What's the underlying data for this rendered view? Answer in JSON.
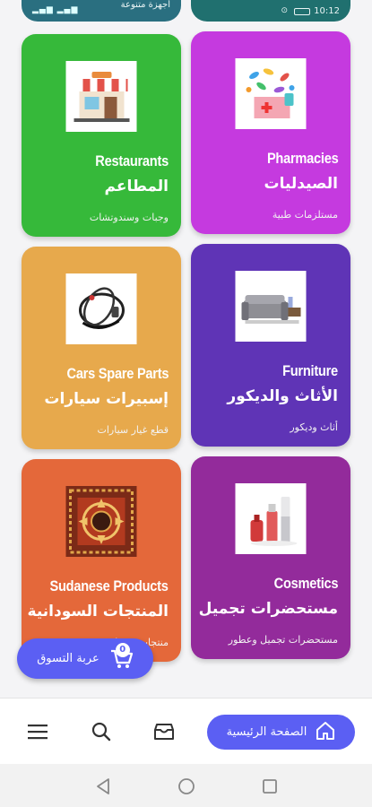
{
  "status_bar": {
    "left_text": "أجهزة متنوعة",
    "time": "10:12"
  },
  "cards": [
    {
      "en": "Restaurants",
      "ar": "المطاعم",
      "sub": "وجبات وسندوتشات",
      "color": "#36b93a",
      "icon": "restaurant-storefront-icon"
    },
    {
      "en": "Pharmacies",
      "ar": "الصيدليات",
      "sub": "مستلزمات طبية",
      "color": "#c53adf",
      "icon": "pharmacy-pills-box-icon"
    },
    {
      "en": "Cars Spare Parts",
      "ar": "إسبيرات سيارات",
      "sub": "قطع غيار سيارات",
      "color": "#e7a94c",
      "icon": "car-parts-icon"
    },
    {
      "en": "Furniture",
      "ar": "الأثاث والديكور",
      "sub": "أثاث وديكور",
      "color": "#5f34b6",
      "icon": "sofa-furniture-icon"
    },
    {
      "en": "Sudanese Products",
      "ar": "المنتجات السودانية",
      "sub": "منتجات سودانية متنوعة",
      "color": "#e4683a",
      "icon": "sudanese-pattern-icon"
    },
    {
      "en": "Cosmetics",
      "ar": "مستحضرات تجميل",
      "sub": "مستحضرات تجميل وعطور",
      "color": "#932b9b",
      "icon": "cosmetics-bottles-icon"
    }
  ],
  "cart": {
    "label": "عربة التسوق",
    "count": "0"
  },
  "bottom_nav": {
    "home_label": "الصفحة الرئيسية"
  },
  "accent": "#5b5ff3"
}
